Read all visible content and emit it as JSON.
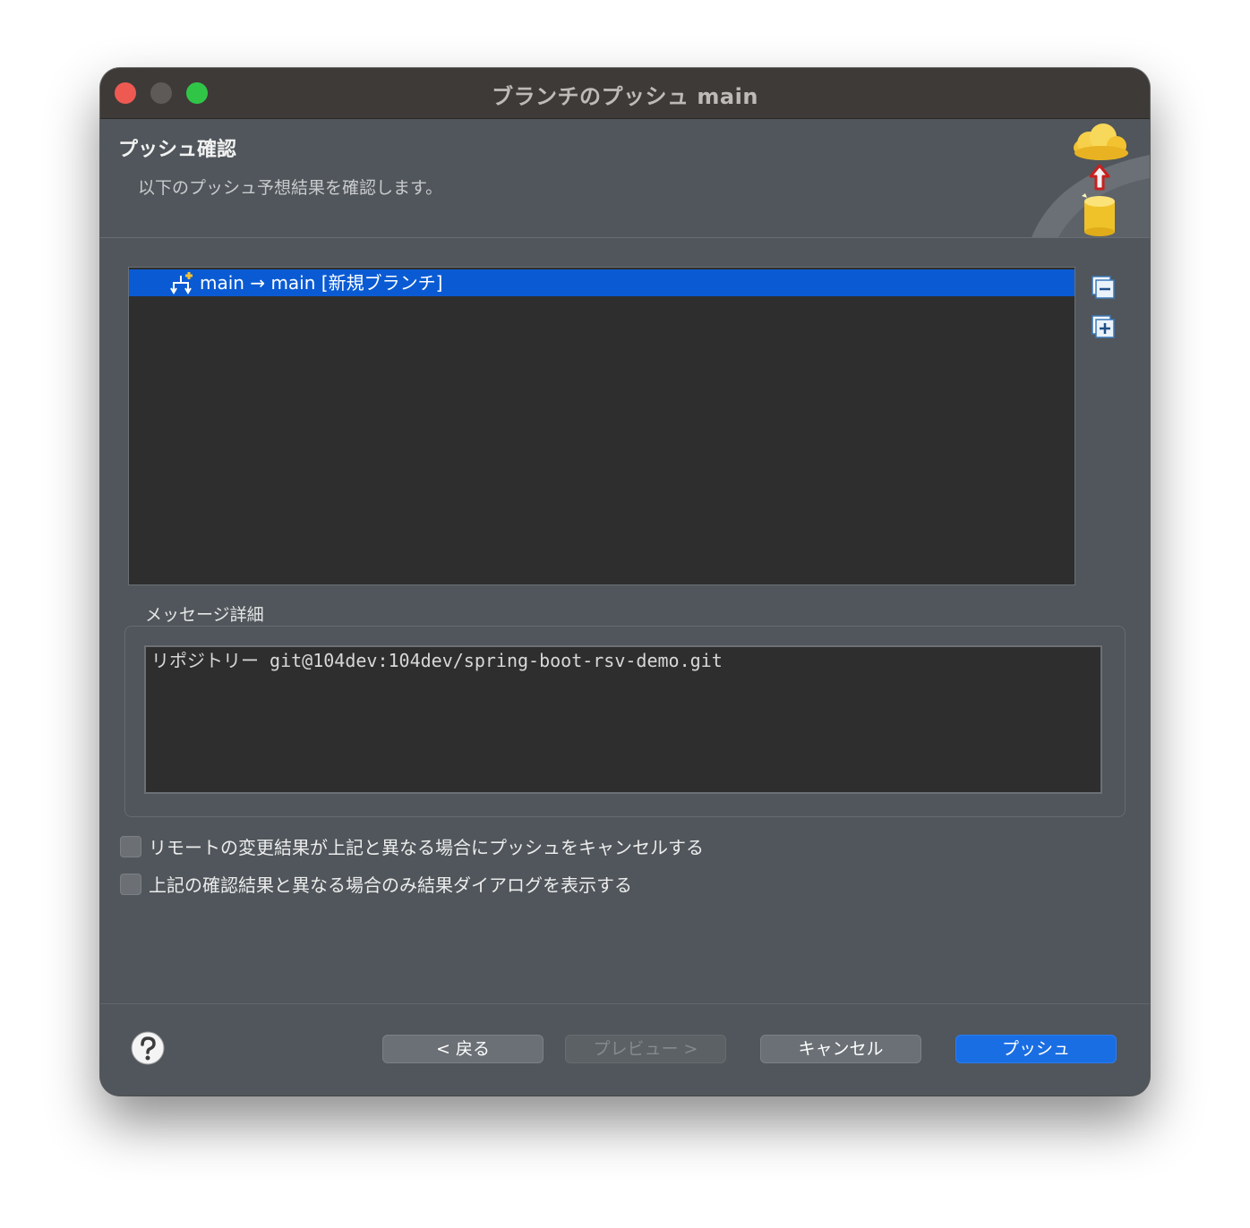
{
  "window": {
    "title": "ブランチのプッシュ main"
  },
  "banner": {
    "title": "プッシュ確認",
    "description": "以下のプッシュ予想結果を確認します。",
    "icon": "push-cloud-icon"
  },
  "tree": {
    "rows": [
      {
        "label": "main → main [新規ブランチ]",
        "icon": "new-branch-icon",
        "selected": true
      }
    ],
    "collapse_all_icon": "collapse-all-icon",
    "expand_all_icon": "expand-all-icon"
  },
  "message_details": {
    "label": "メッセージ詳細",
    "text": "リポジトリー git@104dev:104dev/spring-boot-rsv-demo.git"
  },
  "options": [
    {
      "label": "リモートの変更結果が上記と異なる場合にプッシュをキャンセルする",
      "checked": false
    },
    {
      "label": "上記の確認結果と異なる場合のみ結果ダイアログを表示する",
      "checked": false
    }
  ],
  "footer": {
    "help_icon": "help-icon",
    "back_label": "< 戻る",
    "preview_label": "プレビュー >",
    "cancel_label": "キャンセル",
    "push_label": "プッシュ"
  },
  "colors": {
    "window_bg": "#50565b",
    "titlebar_bg": "#3e3a38",
    "selection": "#0a5bd3",
    "primary_button": "#1a6ee3",
    "close": "#ee5a52",
    "maximize": "#31c548"
  }
}
